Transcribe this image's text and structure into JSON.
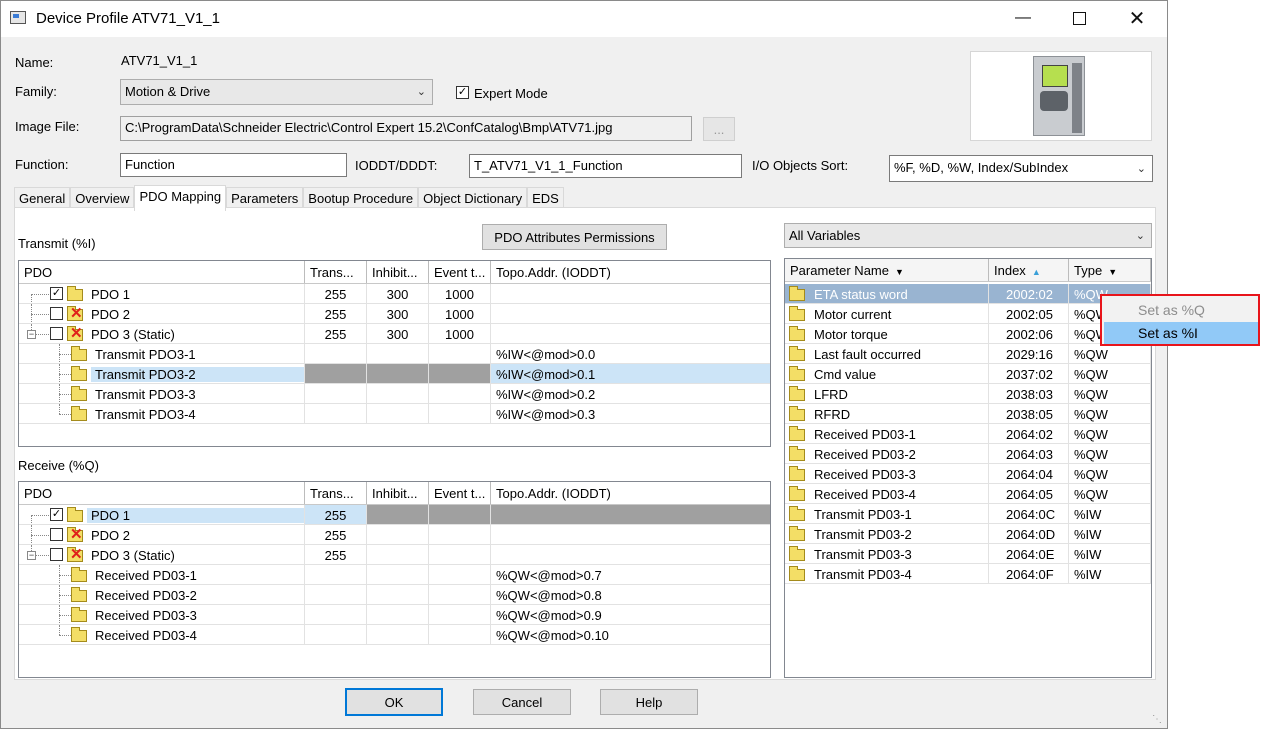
{
  "window": {
    "title": "Device Profile ATV71_V1_1"
  },
  "header": {
    "name_label": "Name:",
    "name_value": "ATV71_V1_1",
    "family_label": "Family:",
    "family_value": "Motion & Drive",
    "expert_mode_label": "Expert Mode",
    "expert_mode_checked": true,
    "image_file_label": "Image File:",
    "image_file_value": "C:\\ProgramData\\Schneider Electric\\Control Expert 15.2\\ConfCatalog\\Bmp\\ATV71.jpg",
    "browse_label": "...",
    "function_label": "Function:",
    "function_value": "Function",
    "ioddt_label": "IODDT/DDDT:",
    "ioddt_value": "T_ATV71_V1_1_Function",
    "sort_label": "I/O Objects Sort:",
    "sort_value": "%F, %D, %W, Index/SubIndex"
  },
  "tabs": [
    "General",
    "Overview",
    "PDO Mapping",
    "Parameters",
    "Bootup Procedure",
    "Object Dictionary",
    "EDS"
  ],
  "active_tab": "PDO Mapping",
  "transmit": {
    "title": "Transmit (%I)",
    "permissions_button": "PDO Attributes Permissions",
    "columns": [
      "PDO",
      "Trans...",
      "Inhibit...",
      "Event t...",
      "Topo.Addr. (IODDT)"
    ],
    "rows": [
      {
        "name": "PDO 1",
        "checked": true,
        "trans": "255",
        "inhibit": "300",
        "event": "1000",
        "topo": ""
      },
      {
        "name": "PDO 2",
        "checked": false,
        "trans": "255",
        "inhibit": "300",
        "event": "1000",
        "topo": ""
      },
      {
        "name": "PDO 3 (Static)",
        "checked": false,
        "trans": "255",
        "inhibit": "300",
        "event": "1000",
        "topo": ""
      },
      {
        "name": "Transmit PDO3-1",
        "trans": "",
        "inhibit": "",
        "event": "",
        "topo": "%IW<@mod>0.0"
      },
      {
        "name": "Transmit PDO3-2",
        "trans": "",
        "inhibit": "",
        "event": "",
        "topo": "%IW<@mod>0.1"
      },
      {
        "name": "Transmit PDO3-3",
        "trans": "",
        "inhibit": "",
        "event": "",
        "topo": "%IW<@mod>0.2"
      },
      {
        "name": "Transmit PDO3-4",
        "trans": "",
        "inhibit": "",
        "event": "",
        "topo": "%IW<@mod>0.3"
      }
    ]
  },
  "receive": {
    "title": "Receive (%Q)",
    "columns": [
      "PDO",
      "Trans...",
      "Inhibit...",
      "Event t...",
      "Topo.Addr. (IODDT)"
    ],
    "rows": [
      {
        "name": "PDO 1",
        "checked": true,
        "trans": "255",
        "inhibit": "",
        "event": "",
        "topo": ""
      },
      {
        "name": "PDO 2",
        "checked": false,
        "trans": "255",
        "inhibit": "",
        "event": "",
        "topo": ""
      },
      {
        "name": "PDO 3 (Static)",
        "checked": false,
        "trans": "255",
        "inhibit": "",
        "event": "",
        "topo": ""
      },
      {
        "name": "Received PD03-1",
        "trans": "",
        "inhibit": "",
        "event": "",
        "topo": "%QW<@mod>0.7"
      },
      {
        "name": "Received PD03-2",
        "trans": "",
        "inhibit": "",
        "event": "",
        "topo": "%QW<@mod>0.8"
      },
      {
        "name": "Received PD03-3",
        "trans": "",
        "inhibit": "",
        "event": "",
        "topo": "%QW<@mod>0.9"
      },
      {
        "name": "Received PD03-4",
        "trans": "",
        "inhibit": "",
        "event": "",
        "topo": "%QW<@mod>0.10"
      }
    ]
  },
  "variables": {
    "filter_value": "All Variables",
    "columns": [
      "Parameter Name",
      "Index",
      "Type"
    ],
    "rows": [
      {
        "name": "ETA status word",
        "index": "2002:02",
        "type": "%QW"
      },
      {
        "name": "Motor current",
        "index": "2002:05",
        "type": "%QW"
      },
      {
        "name": "Motor torque",
        "index": "2002:06",
        "type": "%QW"
      },
      {
        "name": "Last fault occurred",
        "index": "2029:16",
        "type": "%QW"
      },
      {
        "name": "Cmd value",
        "index": "2037:02",
        "type": "%QW"
      },
      {
        "name": "LFRD",
        "index": "2038:03",
        "type": "%QW"
      },
      {
        "name": "RFRD",
        "index": "2038:05",
        "type": "%QW"
      },
      {
        "name": "Received PD03-1",
        "index": "2064:02",
        "type": "%QW"
      },
      {
        "name": "Received PD03-2",
        "index": "2064:03",
        "type": "%QW"
      },
      {
        "name": "Received PD03-3",
        "index": "2064:04",
        "type": "%QW"
      },
      {
        "name": "Received PD03-4",
        "index": "2064:05",
        "type": "%QW"
      },
      {
        "name": "Transmit PD03-1",
        "index": "2064:0C",
        "type": "%IW"
      },
      {
        "name": "Transmit PD03-2",
        "index": "2064:0D",
        "type": "%IW"
      },
      {
        "name": "Transmit PD03-3",
        "index": "2064:0E",
        "type": "%IW"
      },
      {
        "name": "Transmit PD03-4",
        "index": "2064:0F",
        "type": "%IW"
      }
    ]
  },
  "context_menu": {
    "items": [
      "Set as %Q",
      "Set as %I"
    ]
  },
  "footer": {
    "ok": "OK",
    "cancel": "Cancel",
    "help": "Help"
  },
  "icons": {
    "minimize": "minimize-icon",
    "maximize": "maximize-icon",
    "close": "close-icon",
    "folder": "folder-icon"
  }
}
